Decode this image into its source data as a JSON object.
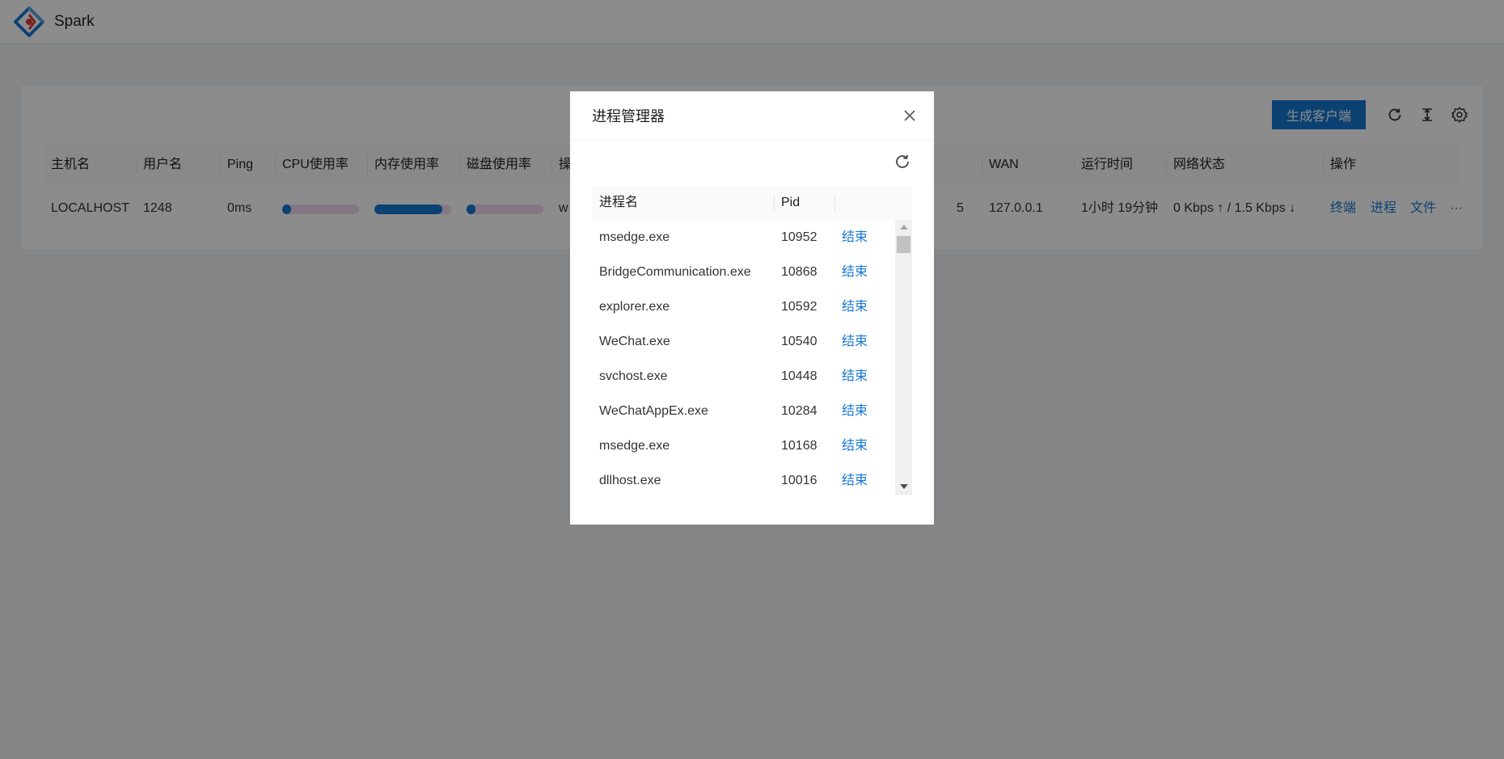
{
  "header": {
    "app_title": "Spark"
  },
  "toolbar": {
    "generate_label": "生成客户端"
  },
  "table": {
    "columns": [
      "主机名",
      "用户名",
      "Ping",
      "CPU使用率",
      "内存使用率",
      "磁盘使用率",
      "操",
      "WAN",
      "运行时间",
      "网络状态",
      "操作"
    ],
    "row": {
      "hostname": "LOCALHOST",
      "username": "1248",
      "ping": "0ms",
      "cpu_usage": 0.06,
      "mem_usage": 0.88,
      "disk_usage": 0.1,
      "os_partial": "w",
      "lan_partial": "5",
      "wan": "127.0.0.1",
      "uptime": "1小时 19分钟",
      "network": "0 Kbps ↑ / 1.5 Kbps ↓",
      "actions": {
        "terminal": "终端",
        "process": "进程",
        "files": "文件",
        "more": "···"
      }
    }
  },
  "modal": {
    "title": "进程管理器",
    "columns": {
      "name": "进程名",
      "pid": "Pid"
    },
    "processes": [
      {
        "name": "msedge.exe",
        "pid": "10952",
        "action": "结束"
      },
      {
        "name": "BridgeCommunication.exe",
        "pid": "10868",
        "action": "结束"
      },
      {
        "name": "explorer.exe",
        "pid": "10592",
        "action": "结束"
      },
      {
        "name": "WeChat.exe",
        "pid": "10540",
        "action": "结束"
      },
      {
        "name": "svchost.exe",
        "pid": "10448",
        "action": "结束"
      },
      {
        "name": "WeChatAppEx.exe",
        "pid": "10284",
        "action": "结束"
      },
      {
        "name": "msedge.exe",
        "pid": "10168",
        "action": "结束"
      },
      {
        "name": "dllhost.exe",
        "pid": "10016",
        "action": "结束"
      }
    ]
  },
  "colors": {
    "primary": "#1677d2",
    "progress_track": "#f0d9f1",
    "logo_blue": "#1677d2",
    "logo_red": "#e0393e"
  },
  "icons": {
    "logo": "spark-logo-icon",
    "refresh": "refresh-icon",
    "column_height": "column-height-icon",
    "settings": "gear-icon",
    "close": "close-icon"
  }
}
